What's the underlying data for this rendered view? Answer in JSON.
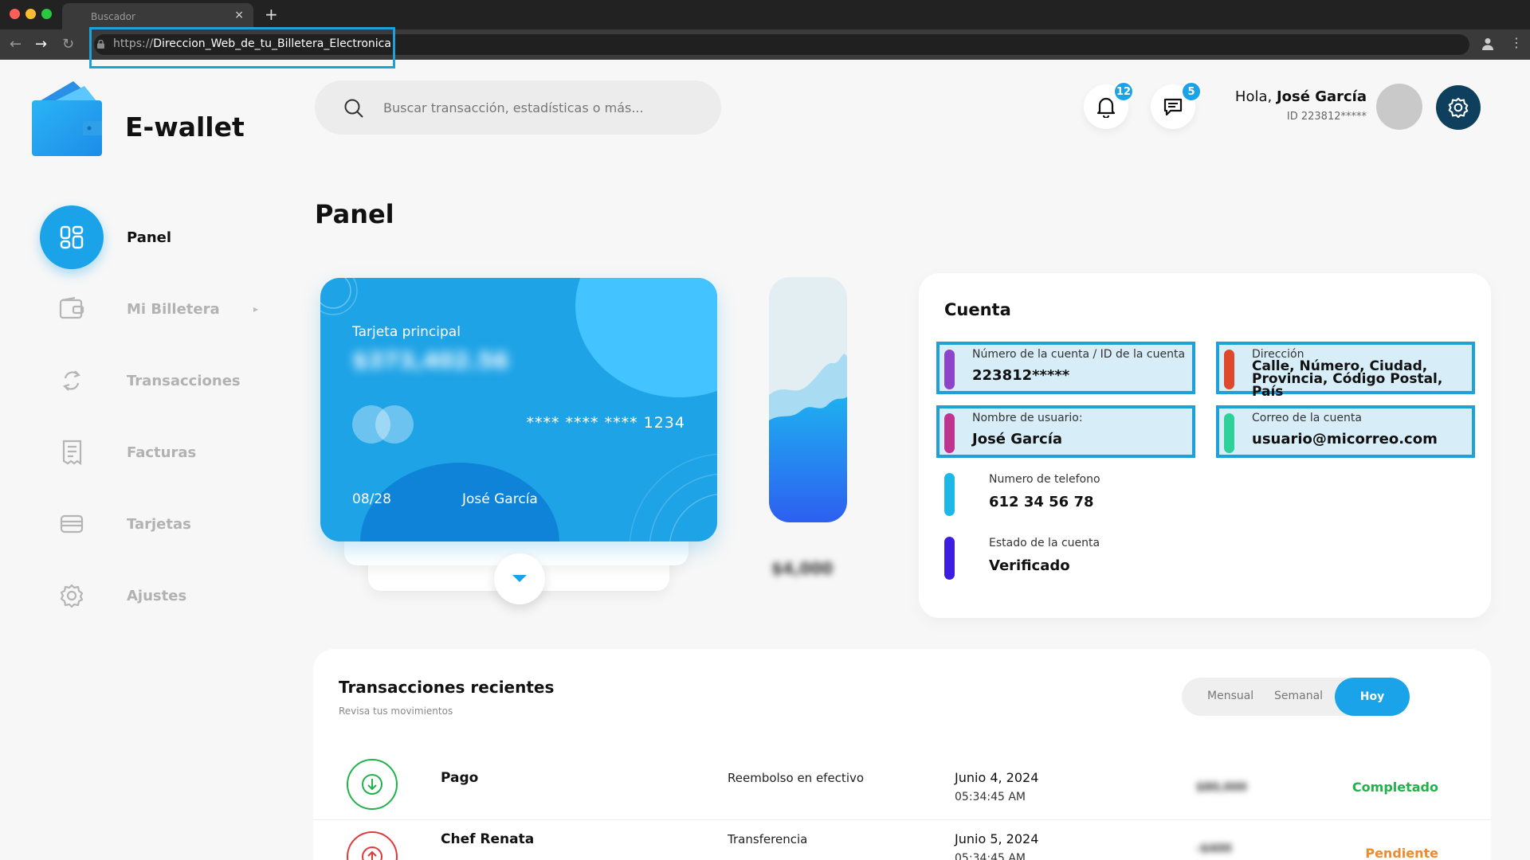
{
  "browser": {
    "tab_title": "Buscador",
    "tab_close": "×",
    "new_tab": "+",
    "url_scheme": "https://",
    "url_rest": "Direccion_Web_de_tu_Billetera_Electronica",
    "back": "←",
    "forward": "→",
    "reload": "↻",
    "menu": "⋮"
  },
  "brand": {
    "name": "E-wallet"
  },
  "sidebar": {
    "items": [
      {
        "label": "Panel",
        "active": true
      },
      {
        "label": "Mi Billetera",
        "arrow": "▸"
      },
      {
        "label": "Transacciones"
      },
      {
        "label": "Facturas"
      },
      {
        "label": "Tarjetas"
      },
      {
        "label": "Ajustes"
      }
    ]
  },
  "header": {
    "search_placeholder": "Buscar transacción, estadísticas o más...",
    "notifications_count": "12",
    "messages_count": "5",
    "greeting": "Hola,",
    "user_name": "José García",
    "user_id": "ID 223812*****"
  },
  "page": {
    "title": "Panel"
  },
  "card": {
    "label": "Tarjeta principal",
    "balance": "$373,402.56",
    "number": "**** **** **** 1234",
    "expiry": "08/28",
    "holder": "José García"
  },
  "mini_chart": {
    "value": "$4,000"
  },
  "account": {
    "title": "Cuenta",
    "fields": [
      {
        "label": "Número de la cuenta / ID de la cuenta",
        "value": "223812*****",
        "color": "#8e44c8"
      },
      {
        "label": "Dirección",
        "value_line1": "Calle, Número, Ciudad,",
        "value_line2": "Provincia, Código Postal, País",
        "color": "#e0482b"
      },
      {
        "label": "Nombre de usuario:",
        "value": "José García",
        "color": "#c0338f"
      },
      {
        "label": "Correo de la cuenta",
        "value": "usuario@micorreo.com",
        "color": "#2fd19b"
      },
      {
        "label": "Numero de telefono",
        "value": "612 34 56 78",
        "color": "#1fb6e8"
      },
      {
        "label": "Estado de la cuenta",
        "value": "Verificado",
        "color": "#3d1ee0"
      }
    ]
  },
  "transactions": {
    "title": "Transacciones recientes",
    "subtitle": "Revisa tus movimientos",
    "periods": {
      "monthly": "Mensual",
      "weekly": "Semanal",
      "today": "Hoy"
    },
    "rows": [
      {
        "name": "Pago",
        "type": "Reembolso en efectivo",
        "date": "Junio 4, 2024",
        "time": "05:34:45 AM",
        "amount": "$80,000",
        "status": "Completado",
        "status_color": "#22b24c",
        "direction": "in"
      },
      {
        "name": "Chef Renata",
        "type": "Transferencia",
        "date": "Junio 5, 2024",
        "time": "05:34:45 AM",
        "amount": "-$400",
        "status": "Pendiente",
        "status_color": "#f08a2a",
        "direction": "out"
      }
    ]
  },
  "colors": {
    "accent": "#1aa3e8",
    "dark": "#0e3f5c",
    "highlight_border": "#1ea0d9"
  }
}
